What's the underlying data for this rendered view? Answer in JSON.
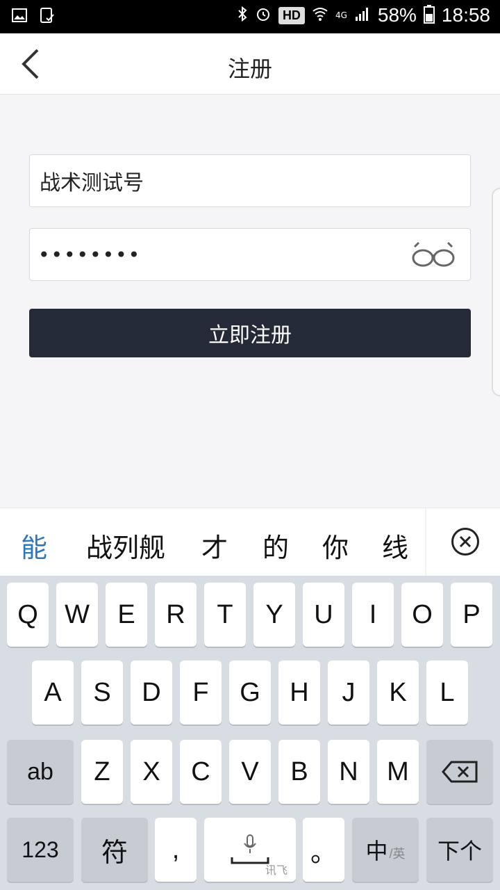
{
  "status_bar": {
    "hd": "HD",
    "network": "4G",
    "battery": "58%",
    "time": "18:58"
  },
  "header": {
    "title": "注册"
  },
  "form": {
    "username_value": "战术测试号",
    "password_value": "••••••••",
    "submit_label": "立即注册"
  },
  "ime": {
    "candidates": [
      "能",
      "战列舰",
      "才",
      "的",
      "你",
      "线"
    ],
    "row1": [
      "Q",
      "W",
      "E",
      "R",
      "T",
      "Y",
      "U",
      "I",
      "O",
      "P"
    ],
    "row2": [
      "A",
      "S",
      "D",
      "F",
      "G",
      "H",
      "J",
      "K",
      "L"
    ],
    "row3": [
      "ab",
      "Z",
      "X",
      "C",
      "V",
      "B",
      "N",
      "M"
    ],
    "row4": {
      "num": "123",
      "symbol": "符",
      "comma": ",",
      "space_brand": "讯飞",
      "period": "。",
      "lang_main": "中",
      "lang_sub": "/英",
      "next": "下个"
    }
  },
  "colors": {
    "button_bg": "#252a38",
    "candidate_accent": "#2e78b7"
  }
}
